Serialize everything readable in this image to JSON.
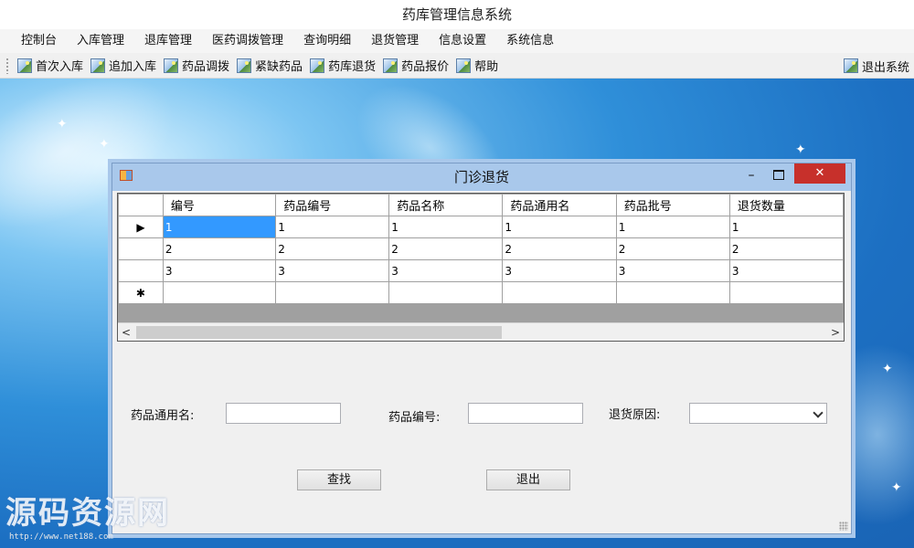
{
  "app": {
    "title": "药库管理信息系统"
  },
  "menu": [
    "控制台",
    "入库管理",
    "退库管理",
    "医药调拨管理",
    "查询明细",
    "退货管理",
    "信息设置",
    "系统信息"
  ],
  "toolbar": {
    "items": [
      {
        "label": "首次入库",
        "icon": "picture-icon"
      },
      {
        "label": "追加入库",
        "icon": "picture-icon"
      },
      {
        "label": "药品调拨",
        "icon": "picture-icon"
      },
      {
        "label": "紧缺药品",
        "icon": "picture-icon"
      },
      {
        "label": "药库退货",
        "icon": "picture-icon"
      },
      {
        "label": "药品报价",
        "icon": "picture-icon"
      },
      {
        "label": "帮助",
        "icon": "picture-icon"
      }
    ],
    "exit_label": "退出系统"
  },
  "dialog": {
    "title": "门诊退货",
    "close_glyph": "✕",
    "minimize_glyph": "–"
  },
  "grid": {
    "columns": [
      "编号",
      "药品编号",
      "药品名称",
      "药品通用名",
      "药品批号",
      "退货数量"
    ],
    "rows": [
      [
        "1",
        "1",
        "1",
        "1",
        "1",
        "1"
      ],
      [
        "2",
        "2",
        "2",
        "2",
        "2",
        "2"
      ],
      [
        "3",
        "3",
        "3",
        "3",
        "3",
        "3"
      ]
    ],
    "current_row_marker": "▶",
    "new_row_marker": "✱",
    "scroll_left": "<",
    "scroll_right": ">"
  },
  "form": {
    "generic_name_label": "药品通用名:",
    "generic_name_value": "",
    "drug_code_label": "药品编号:",
    "drug_code_value": "",
    "reason_label": "退货原因:",
    "reason_value": "",
    "search_button": "查找",
    "exit_button": "退出"
  },
  "watermark": {
    "text": "源码资源网",
    "url": "http://www.net188.com"
  },
  "colors": {
    "selection": "#3399ff",
    "close": "#c7302b",
    "dialog_title": "#a9c8eb"
  }
}
